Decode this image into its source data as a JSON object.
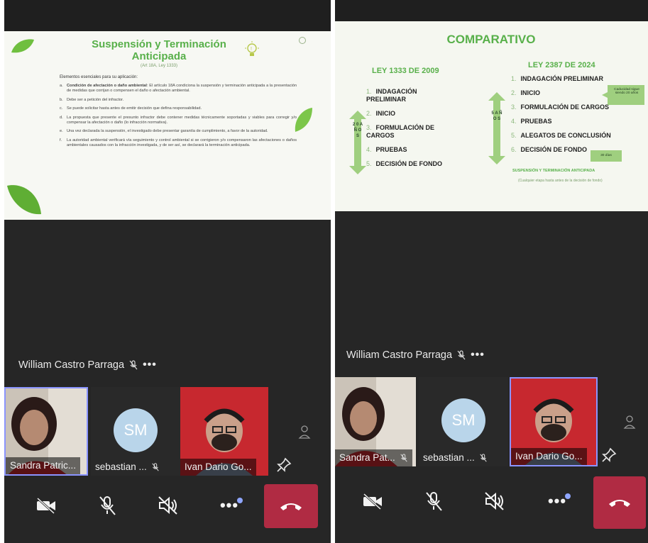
{
  "left": {
    "slide": {
      "title": "Suspensión y Terminación Anticipada",
      "subtitle": "(Art 18A, Ley 1333)",
      "intro": "Elementos esenciales para su aplicación:",
      "items": [
        {
          "mark": "a.",
          "bold": "Condición de afectación o daño ambiental",
          "text": ": El artículo 18A condiciona la suspensión y terminación anticipada a la presentación de medidas que corrijan o compensen el daño o afectación ambiental."
        },
        {
          "mark": "b.",
          "bold": "",
          "text": "Debe ser a petición del infractor."
        },
        {
          "mark": "c.",
          "bold": "",
          "text": "Se puede solicitar hasta antes de emitir decisión que defina responsabilidad."
        },
        {
          "mark": "d.",
          "bold": "",
          "text": "La propuesta que presente el presunto infractor debe contener medidas técnicamente soportadas y viables para corregir y/o compensar la afectación o daño (lo infracción normativa)."
        },
        {
          "mark": "e.",
          "bold": "",
          "text": "Una vez declarada la suspensión, el investigado debe presentar garantía de cumplimiento, a favor de la autoridad."
        },
        {
          "mark": "f.",
          "bold": "",
          "text": "La autoridad ambiental verificará vía seguimiento y control ambiental si se corrigieron y/o compensaron las afectaciones o daños ambientales causados con la infracción investigada, y de ser así, se declarará la terminación anticipada."
        }
      ]
    },
    "speaker": "William Castro Parraga",
    "tiles": [
      {
        "name": "Sandra Patric...",
        "muted": false
      },
      {
        "name": "sebastian ...",
        "initials": "SM",
        "muted": true
      },
      {
        "name": "Ivan Dario Go...",
        "muted": false
      }
    ]
  },
  "right": {
    "slide": {
      "title": "COMPARATIVO",
      "col1_head": "LEY 1333 DE 2009",
      "col1_items": [
        "INDAGACIÓN PRELIMINAR",
        "INICIO",
        "FORMULACIÓN DE CARGOS",
        "PRUEBAS",
        "DECISIÓN DE FONDO"
      ],
      "col1_nums": [
        "1.",
        "2.",
        "3.",
        "4.",
        "5."
      ],
      "col1_arrow_label": "2 0 A Ñ O S",
      "col2_head": "LEY 2387 DE 2024",
      "col2_items": [
        "INDAGACIÓN PRELIMINAR",
        "INICIO",
        "FORMULACIÓN DE CARGOS",
        "PRUEBAS",
        "ALEGATOS DE CONCLUSIÓN",
        "DECISIÓN DE FONDO"
      ],
      "col2_nums": [
        "1.",
        "2.",
        "3.",
        "4.",
        "5.",
        "6."
      ],
      "col2_arrow_label": "5 A Ñ O S",
      "note_caducidad": "Caducidad sigue siendo 20 años",
      "note_dias": "30 días",
      "susp_title": "SUSPENSIÓN Y TERMINACIÓN ANTICIPADA",
      "susp_sub": "(Cualquier etapa hasta antes de la decisión de fondo)"
    },
    "speaker": "William Castro Parraga",
    "tiles": [
      {
        "name": "Sandra Pat...",
        "muted": true
      },
      {
        "name": "sebastian ...",
        "initials": "SM",
        "muted": true
      },
      {
        "name": "Ivan Dario Go...",
        "muted": false
      }
    ]
  },
  "colors": {
    "accent_green": "#58b04a",
    "hangup_red": "#b02b43",
    "selection": "#8a94ff",
    "avatar_blue": "#b9d5ea"
  }
}
